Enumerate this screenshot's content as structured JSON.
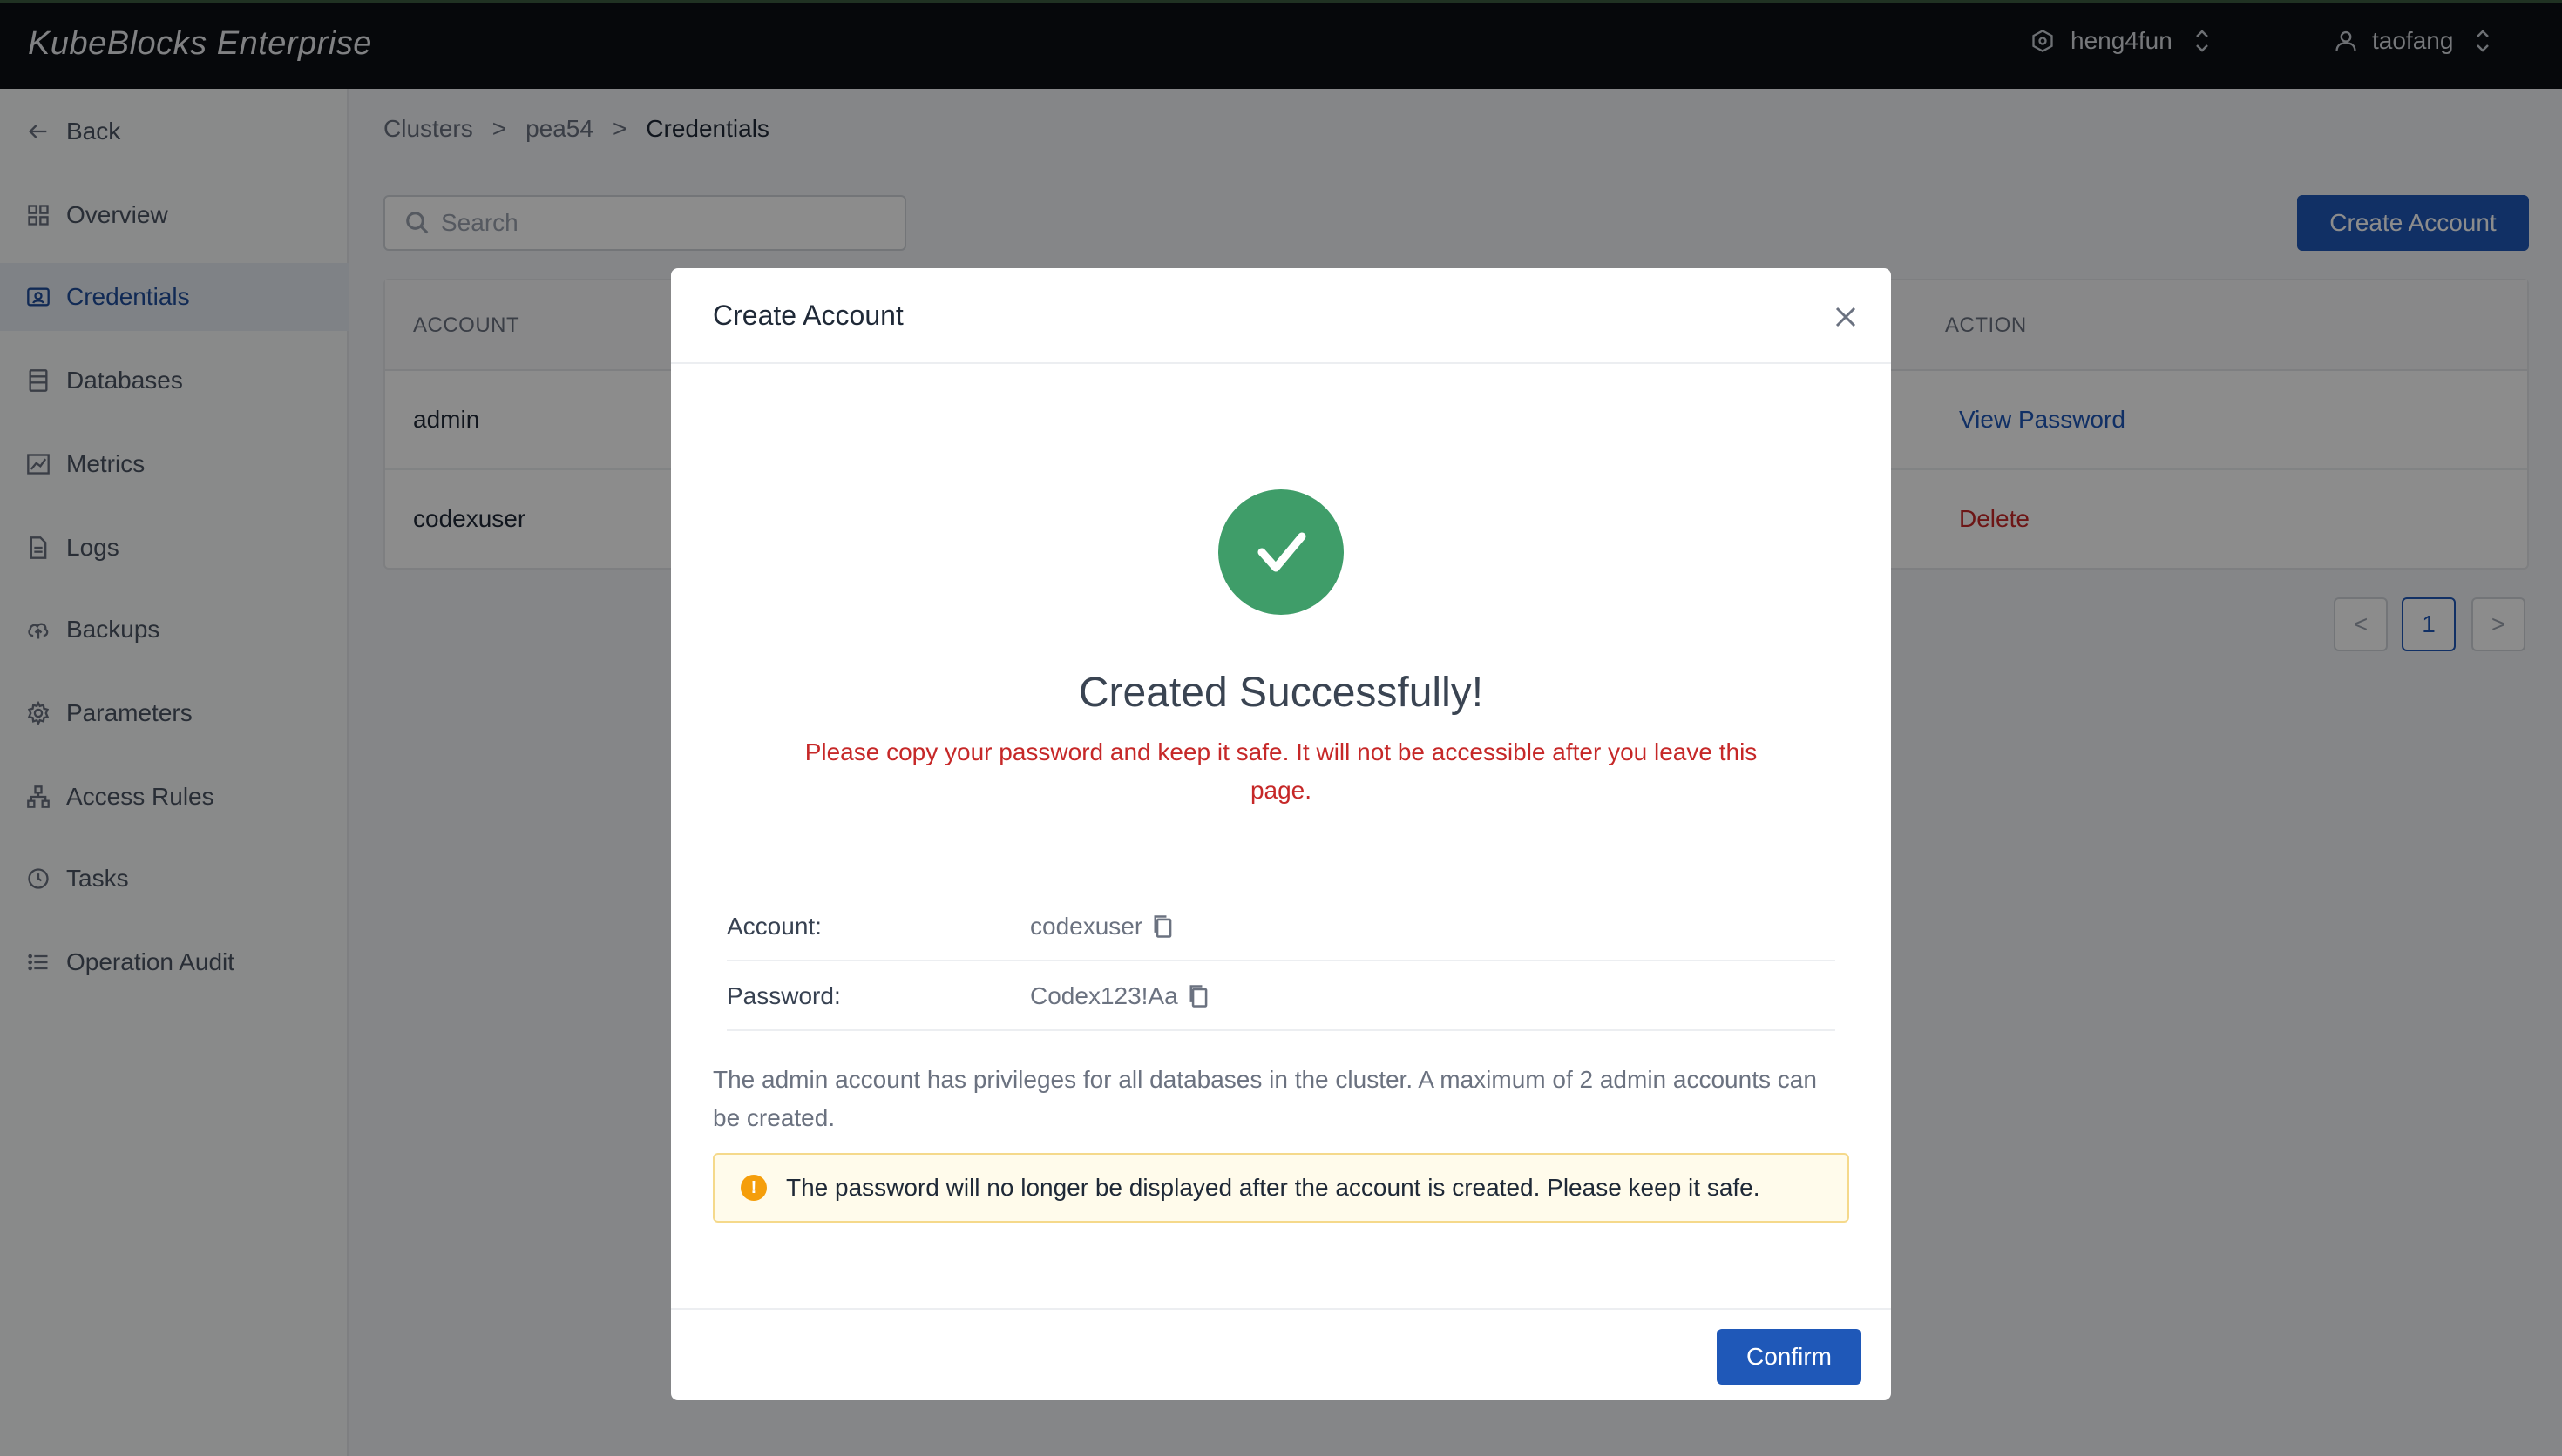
{
  "app": {
    "title": "KubeBlocks Enterprise",
    "workspace": "heng4fun",
    "user": "taofang"
  },
  "sidebar": {
    "items": [
      {
        "label": "Back",
        "icon": "arrow-left-icon"
      },
      {
        "label": "Overview",
        "icon": "grid-icon"
      },
      {
        "label": "Credentials",
        "icon": "id-card-icon",
        "active": true
      },
      {
        "label": "Databases",
        "icon": "database-icon"
      },
      {
        "label": "Metrics",
        "icon": "chart-icon"
      },
      {
        "label": "Logs",
        "icon": "file-icon"
      },
      {
        "label": "Backups",
        "icon": "cloud-upload-icon"
      },
      {
        "label": "Parameters",
        "icon": "gear-icon"
      },
      {
        "label": "Access Rules",
        "icon": "network-icon"
      },
      {
        "label": "Tasks",
        "icon": "clock-icon"
      },
      {
        "label": "Operation Audit",
        "icon": "list-icon"
      }
    ]
  },
  "breadcrumb": {
    "items": [
      "Clusters",
      "pea54",
      "Credentials"
    ],
    "separator": ">"
  },
  "search": {
    "placeholder": "Search",
    "value": ""
  },
  "toolbar": {
    "create_label": "Create Account"
  },
  "table": {
    "headers": [
      "ACCOUNT",
      "ACTION"
    ],
    "rows": [
      {
        "account": "admin",
        "action": "View Password"
      },
      {
        "account": "codexuser",
        "action": "Delete"
      }
    ]
  },
  "pagination": {
    "prev": "<",
    "current": "1",
    "next": ">"
  },
  "modal": {
    "title": "Create Account",
    "success_title": "Created Successfully!",
    "warning": "Please copy your password and keep it safe. It will not be accessible after you leave this page.",
    "fields": [
      {
        "label": "Account:",
        "value": "codexuser"
      },
      {
        "label": "Password:",
        "value": "Codex123!Aa"
      }
    ],
    "admin_note": "The admin account has privileges for all databases in the cluster. A maximum of 2 admin accounts can be created.",
    "alert": "The password will no longer be displayed after the account is created. Please keep it safe.",
    "alert_icon": "!",
    "confirm_label": "Confirm"
  },
  "colors": {
    "primary": "#1f58b8",
    "success": "#3f9d69",
    "danger": "#c62828",
    "warning": "#f59e0b",
    "topbar": "#0c0f14"
  }
}
